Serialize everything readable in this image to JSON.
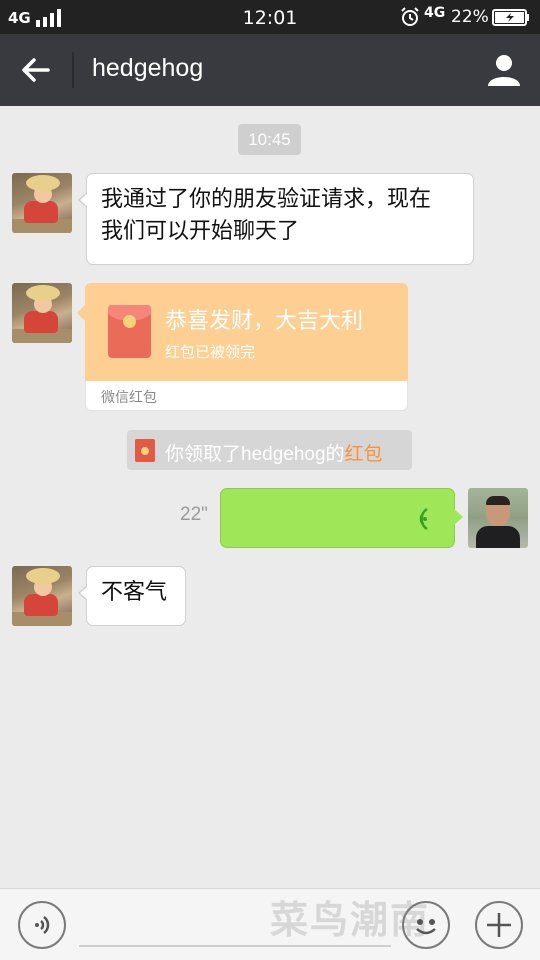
{
  "status_bar": {
    "network": "4G",
    "time": "12:01",
    "network2": "4G",
    "battery": "22%"
  },
  "nav": {
    "title": "hedgehog"
  },
  "chat": {
    "timestamp": "10:45",
    "msg1_line1": "我通过了你的朋友验证请求，现在",
    "msg1_line2": "我们可以开始聊天了",
    "red_packet": {
      "greeting": "恭喜发财，大吉大利",
      "status": "红包已被领完",
      "source": "微信红包"
    },
    "system_msg": {
      "prefix": "你领取了hedgehog的",
      "highlight": "红包"
    },
    "voice_duration": "22\"",
    "msg3": "不客气"
  },
  "watermark": {
    "text": "菜鸟潮南"
  },
  "icons": {
    "back": "back-arrow-icon",
    "profile": "profile-icon",
    "voice_toggle": "voice-input-icon",
    "emoji": "emoji-icon",
    "more": "plus-icon"
  },
  "colors": {
    "nav_bg": "#393a3f",
    "chat_bg": "#ebebeb",
    "voice_bubble": "#9fe658",
    "red_packet": "#fecf93",
    "highlight": "#f7933a"
  }
}
